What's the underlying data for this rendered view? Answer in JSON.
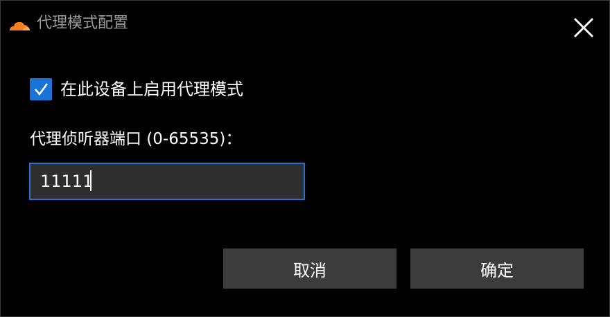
{
  "window": {
    "title": "代理模式配置",
    "app_icon": "cloudflare-cloud-icon",
    "close_icon": "close-icon"
  },
  "proxy_mode": {
    "checkbox_label": "在此设备上启用代理模式",
    "checked": true
  },
  "port": {
    "label": "代理侦听器端口 (0-65535)：",
    "value": "11111"
  },
  "buttons": {
    "cancel_label": "取消",
    "ok_label": "确定"
  },
  "colors": {
    "background": "#000000",
    "accent": "#1a73d9",
    "input_border": "#2b6fd6",
    "button_bg": "#3c3c3c",
    "brand_orange": "#f38020"
  }
}
